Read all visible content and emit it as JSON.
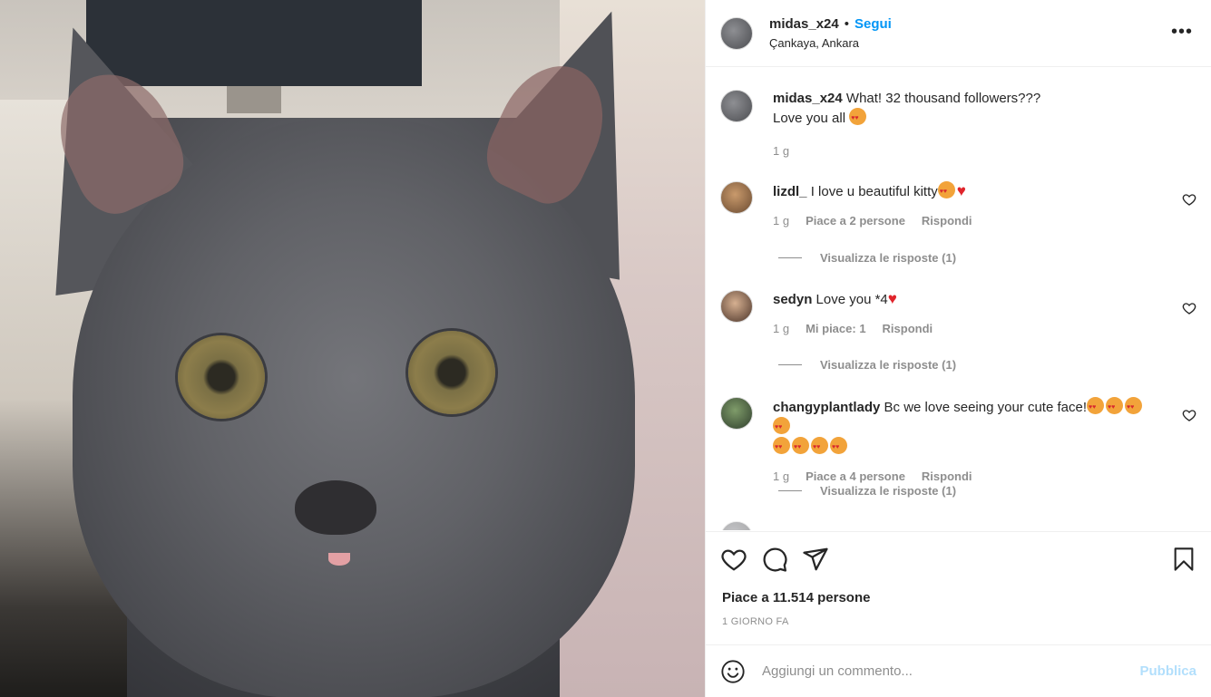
{
  "post": {
    "username": "midas_x24",
    "separator": "•",
    "follow_label": "Segui",
    "location": "Çankaya, Ankara",
    "more_icon": "more-horizontal-icon"
  },
  "caption": {
    "username": "midas_x24",
    "text_line1": "What! 32 thousand followers???",
    "text_line2": "Love you all",
    "time": "1 g"
  },
  "comments": [
    {
      "username": "lizdl_",
      "text": "I love u beautiful kitty",
      "time": "1 g",
      "likes": "Piace a 2 persone",
      "reply": "Rispondi",
      "view_replies": "Visualizza le risposte (1)"
    },
    {
      "username": "sedyn",
      "text": "Love you *4",
      "time": "1 g",
      "likes": "Mi piace: 1",
      "reply": "Rispondi",
      "view_replies": "Visualizza le risposte (1)"
    },
    {
      "username": "changyplantlady",
      "text": "Bc we love seeing your cute face!",
      "time": "1 g",
      "likes": "Piace a 4 persone",
      "reply": "Rispondi",
      "view_replies": "Visualizza le risposte (1)"
    }
  ],
  "footer": {
    "likes_text": "Piace a 11.514 persone",
    "timestamp": "1 GIORNO FA",
    "comment_placeholder": "Aggiungi un commento...",
    "publish_label": "Pubblica"
  },
  "colors": {
    "accent": "#0095f6",
    "publish_disabled": "#b2dffc",
    "muted": "#8e8e8e"
  }
}
